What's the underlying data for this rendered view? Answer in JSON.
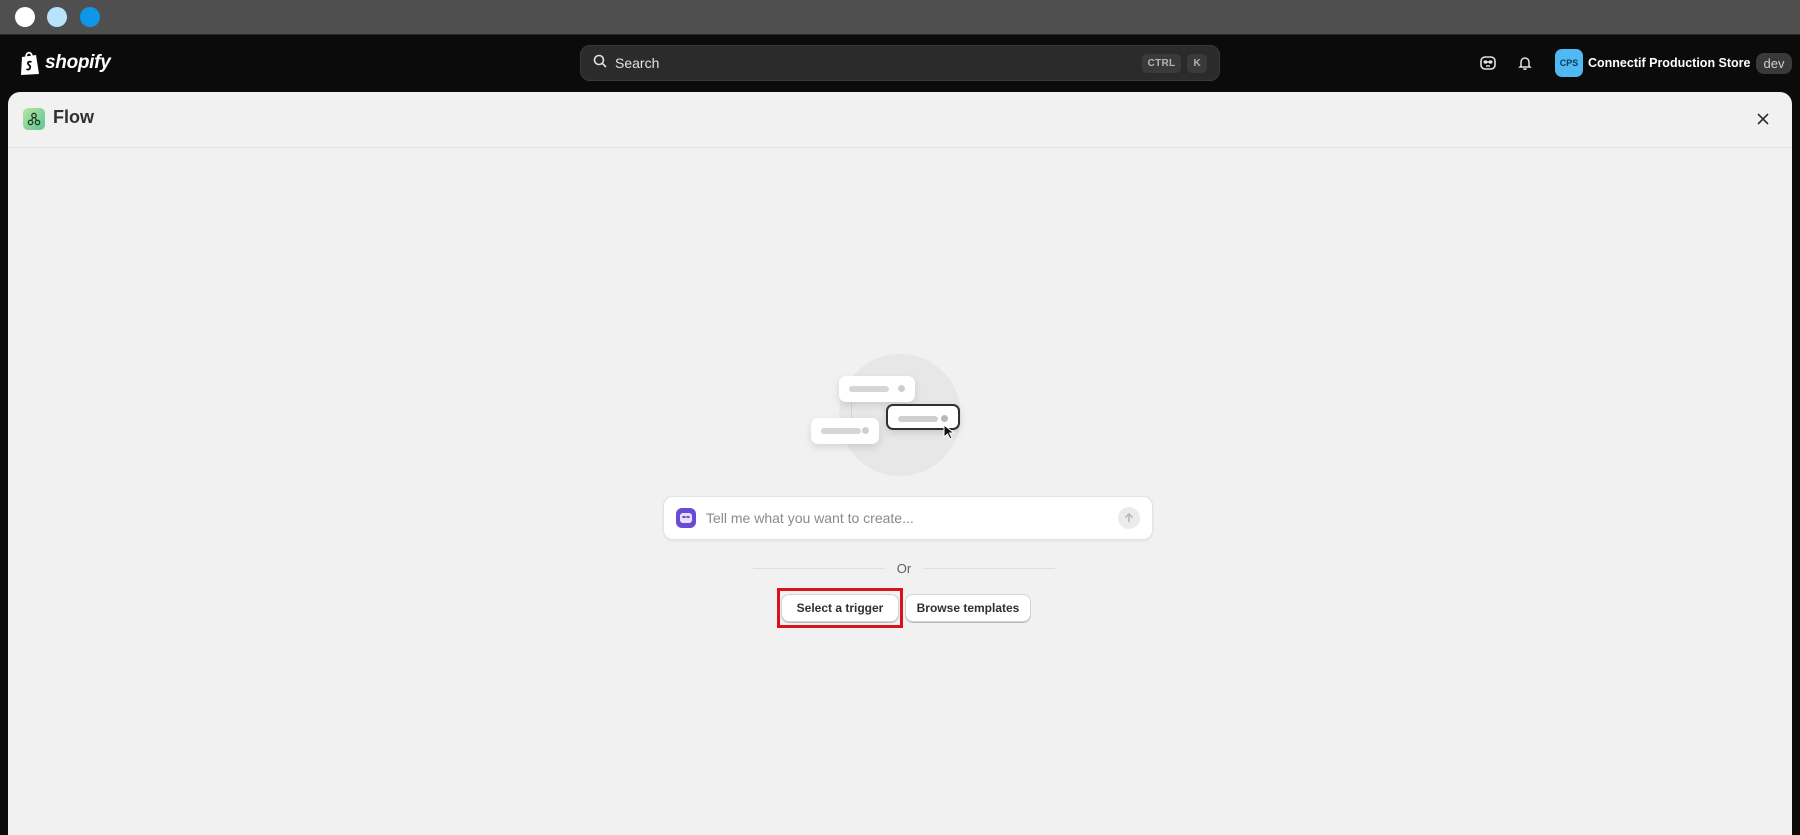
{
  "brand": {
    "name": "shopify"
  },
  "search": {
    "label": "Search",
    "shortcut": [
      "CTRL",
      "K"
    ]
  },
  "store": {
    "initials": "CPS",
    "name": "Connectif Production Store",
    "badge": "dev",
    "avatar_color": "#4fb9f3"
  },
  "app": {
    "title": "Flow"
  },
  "prompt": {
    "placeholder": "Tell me what you want to create..."
  },
  "divider": {
    "label": "Or"
  },
  "actions": {
    "select_trigger": "Select a trigger",
    "browse_templates": "Browse templates"
  },
  "colors": {
    "highlight": "#d9121b",
    "sidekick": "#6b4ad6"
  }
}
